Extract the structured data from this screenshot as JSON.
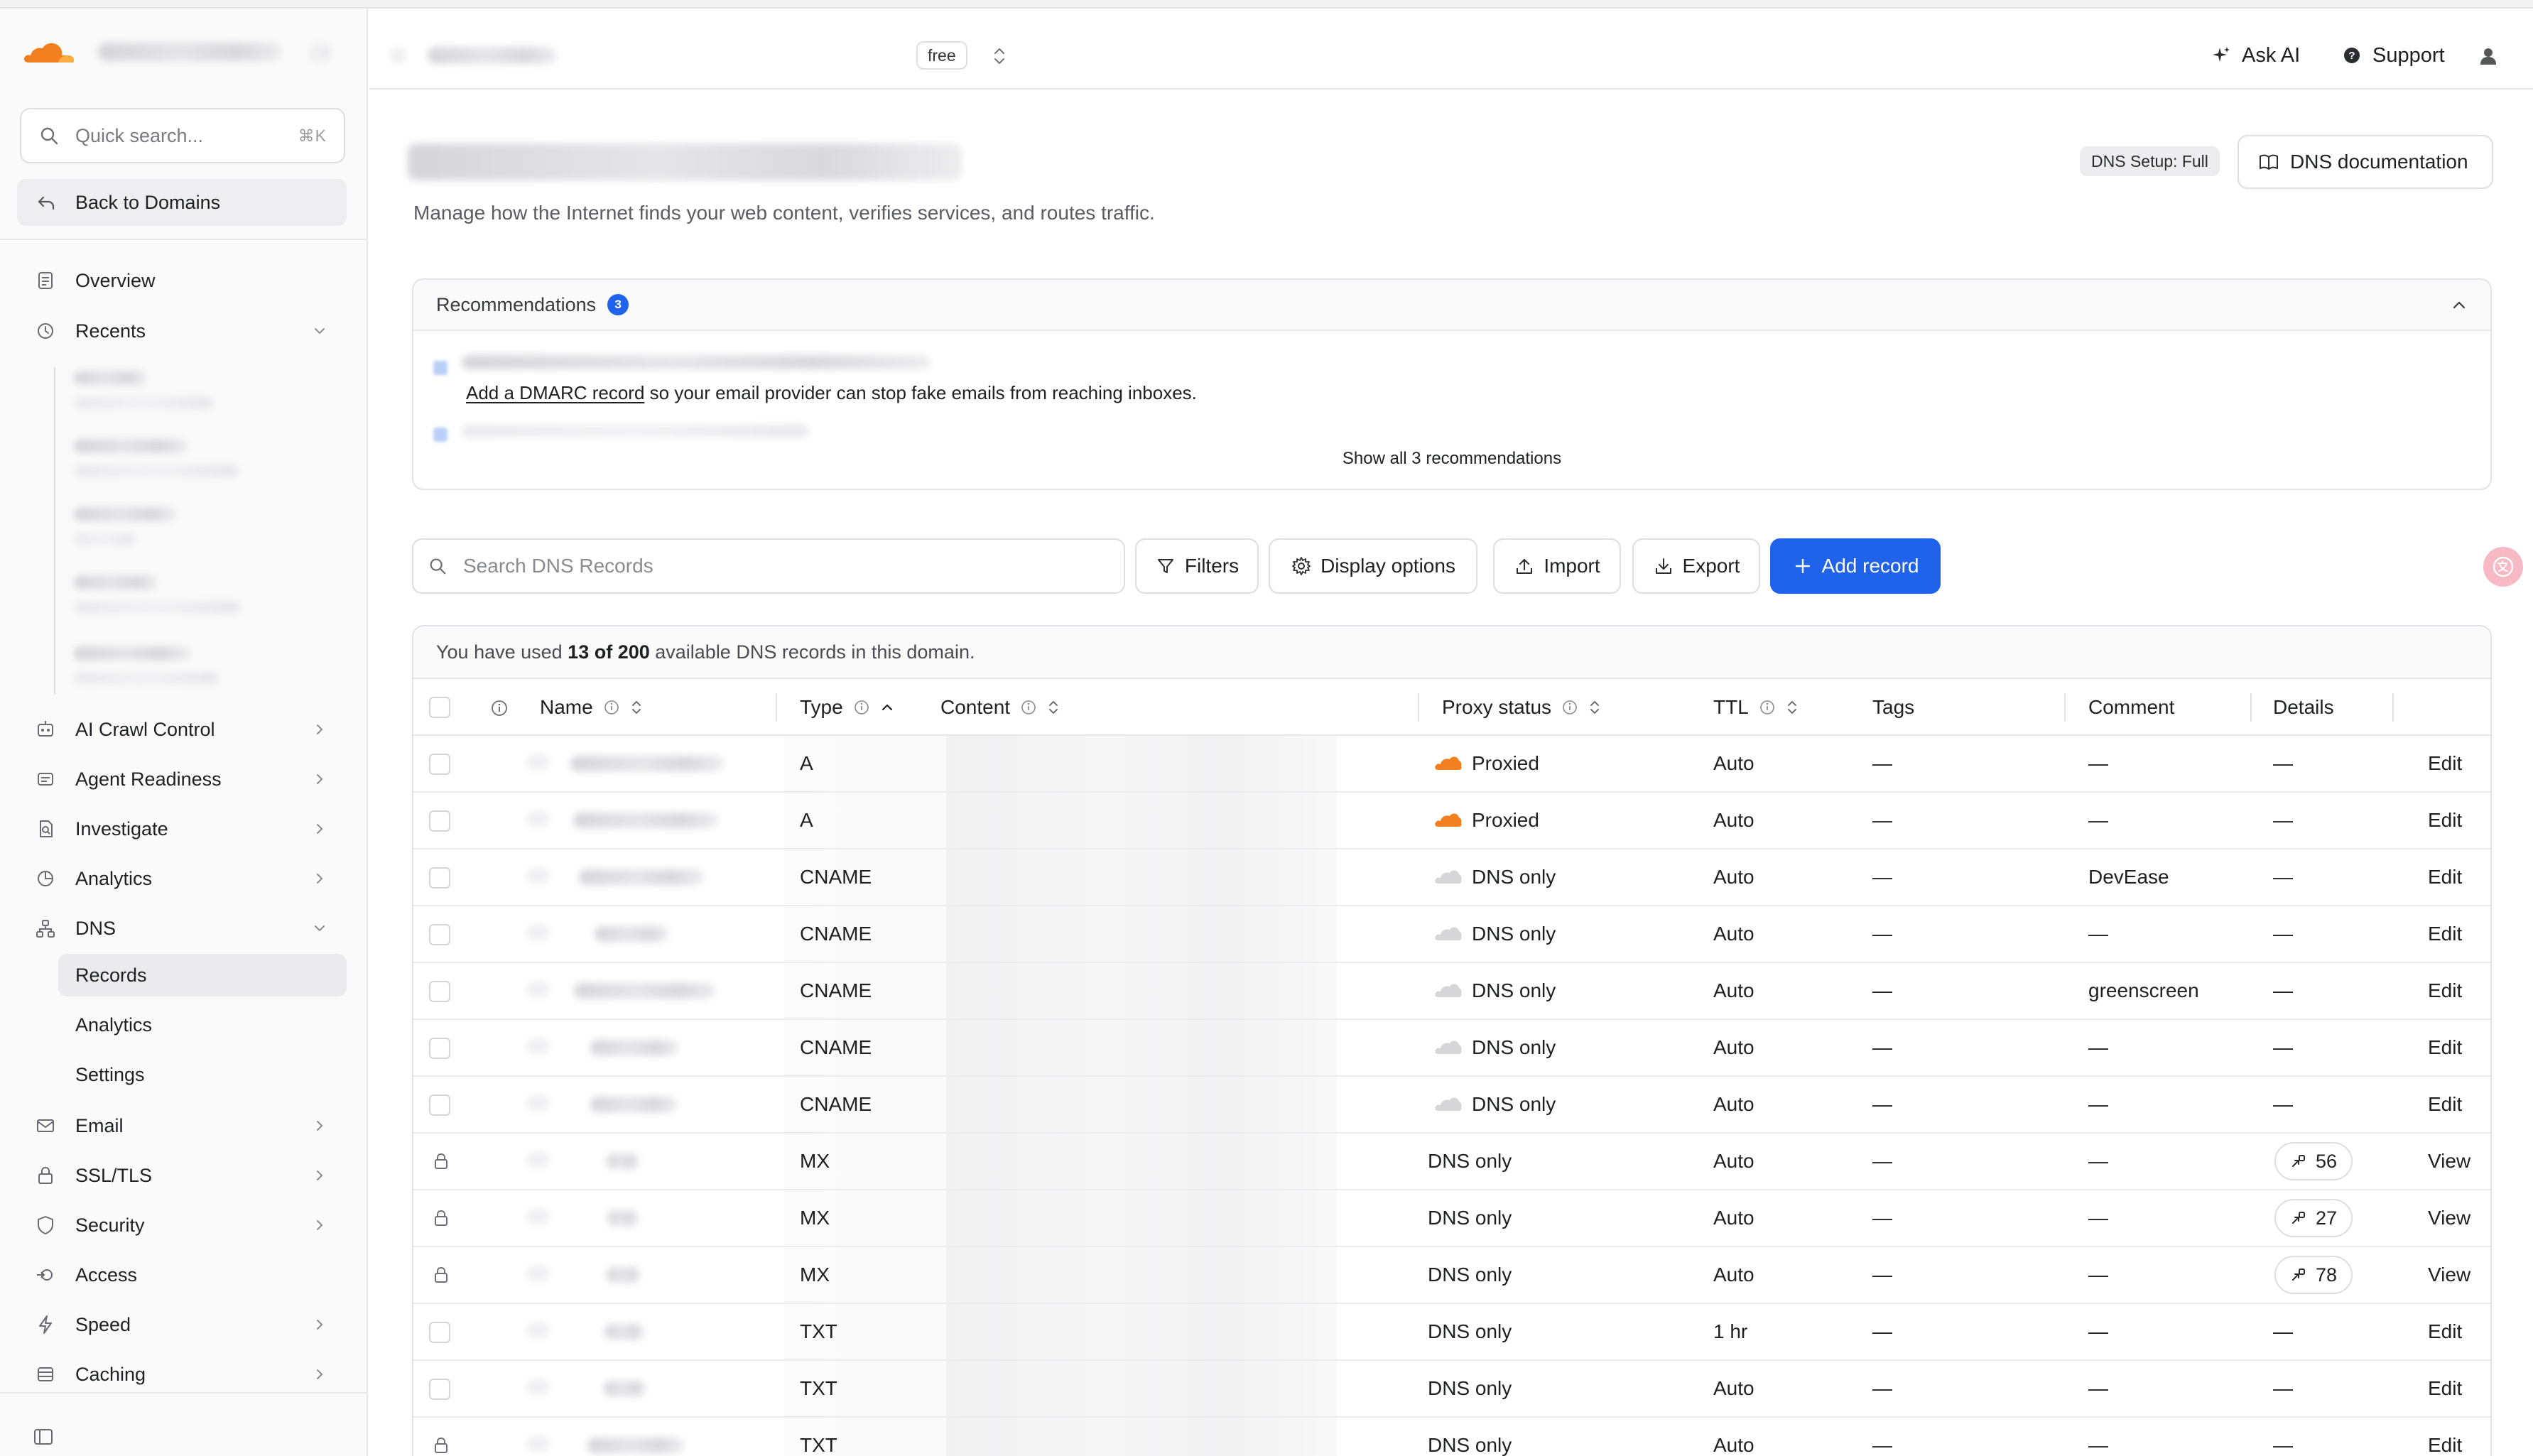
{
  "app": {
    "account_name": "",
    "plan": "free",
    "top_actions": {
      "ask_ai": "Ask AI",
      "support": "Support"
    },
    "accent_color": "#1f63ea",
    "brand_color": "#f38020"
  },
  "sidebar": {
    "search_placeholder": "Quick search...",
    "search_shortcut": "⌘K",
    "back_label": "Back to Domains",
    "overview": "Overview",
    "recents": "Recents",
    "recent_items": [
      {
        "title": "",
        "subtitle": ""
      },
      {
        "title": "",
        "subtitle": ""
      },
      {
        "title": "",
        "subtitle": ""
      },
      {
        "title": "",
        "subtitle": ""
      },
      {
        "title": "",
        "subtitle": ""
      }
    ],
    "nav": [
      {
        "label": "AI Crawl Control",
        "icon": "crawl-icon",
        "chevron": true
      },
      {
        "label": "Agent Readiness",
        "icon": "agent-icon",
        "chevron": true
      },
      {
        "label": "Investigate",
        "icon": "investigate-icon",
        "chevron": true
      },
      {
        "label": "Analytics",
        "icon": "analytics-icon",
        "chevron": true
      },
      {
        "label": "DNS",
        "icon": "dns-icon",
        "chevron": true,
        "expanded": true
      }
    ],
    "dns_sub": [
      {
        "label": "Records",
        "active": true
      },
      {
        "label": "Analytics",
        "active": false
      },
      {
        "label": "Settings",
        "active": false
      }
    ],
    "nav_after": [
      {
        "label": "Email",
        "icon": "email-icon",
        "chevron": true
      },
      {
        "label": "SSL/TLS",
        "icon": "lock-icon",
        "chevron": true
      },
      {
        "label": "Security",
        "icon": "shield-icon",
        "chevron": true
      },
      {
        "label": "Access",
        "icon": "access-icon",
        "chevron": false
      },
      {
        "label": "Speed",
        "icon": "lightning-icon",
        "chevron": true
      },
      {
        "label": "Caching",
        "icon": "caching-icon",
        "chevron": true
      }
    ]
  },
  "header": {
    "title": "",
    "subtitle": "Manage how the Internet finds your web content, verifies services, and routes traffic.",
    "setup_badge": "DNS Setup: Full",
    "doc_button": "DNS documentation"
  },
  "recommendations": {
    "title": "Recommendations",
    "count": "3",
    "dmarc_link": "Add a DMARC record",
    "dmarc_text": " so your email provider can stop fake emails from reaching inboxes.",
    "show_all": "Show all 3 recommendations"
  },
  "toolbar": {
    "search_placeholder": "Search DNS Records",
    "filters": "Filters",
    "display_options": "Display options",
    "import": "Import",
    "export": "Export",
    "add_record": "Add record"
  },
  "usage": {
    "prefix": "You have used ",
    "used": "13 of 200",
    "suffix": " available DNS records in this domain."
  },
  "table": {
    "columns": {
      "name": "Name",
      "type": "Type",
      "content": "Content",
      "proxy_status": "Proxy status",
      "ttl": "TTL",
      "tags": "Tags",
      "comment": "Comment",
      "details": "Details"
    },
    "rows": [
      {
        "name": "",
        "type": "A",
        "content": "",
        "proxy": "Proxied",
        "proxied": true,
        "ttl": "Auto",
        "tags": "—",
        "comment": "—",
        "details": "—",
        "priority": "",
        "action": "Edit",
        "locked": false
      },
      {
        "name": "",
        "type": "A",
        "content": "",
        "proxy": "Proxied",
        "proxied": true,
        "ttl": "Auto",
        "tags": "—",
        "comment": "—",
        "details": "—",
        "priority": "",
        "action": "Edit",
        "locked": false
      },
      {
        "name": "",
        "type": "CNAME",
        "content": "",
        "proxy": "DNS only",
        "proxied": false,
        "ttl": "Auto",
        "tags": "—",
        "comment": "DevEase",
        "details": "—",
        "priority": "",
        "action": "Edit",
        "locked": false
      },
      {
        "name": "",
        "type": "CNAME",
        "content": "",
        "proxy": "DNS only",
        "proxied": false,
        "ttl": "Auto",
        "tags": "—",
        "comment": "—",
        "details": "—",
        "priority": "",
        "action": "Edit",
        "locked": false
      },
      {
        "name": "",
        "type": "CNAME",
        "content": "",
        "proxy": "DNS only",
        "proxied": false,
        "ttl": "Auto",
        "tags": "—",
        "comment": "greenscreen",
        "details": "—",
        "priority": "",
        "action": "Edit",
        "locked": false
      },
      {
        "name": "",
        "type": "CNAME",
        "content": "",
        "proxy": "DNS only",
        "proxied": false,
        "ttl": "Auto",
        "tags": "—",
        "comment": "—",
        "details": "—",
        "priority": "",
        "action": "Edit",
        "locked": false
      },
      {
        "name": "",
        "type": "CNAME",
        "content": "",
        "proxy": "DNS only",
        "proxied": false,
        "ttl": "Auto",
        "tags": "—",
        "comment": "—",
        "details": "—",
        "priority": "",
        "action": "Edit",
        "locked": false
      },
      {
        "name": "",
        "type": "MX",
        "content": "",
        "proxy": "DNS only",
        "proxied": false,
        "ttl": "Auto",
        "tags": "—",
        "comment": "—",
        "details": "",
        "priority": "56",
        "action": "View",
        "locked": true
      },
      {
        "name": "",
        "type": "MX",
        "content": "",
        "proxy": "DNS only",
        "proxied": false,
        "ttl": "Auto",
        "tags": "—",
        "comment": "—",
        "details": "",
        "priority": "27",
        "action": "View",
        "locked": true
      },
      {
        "name": "",
        "type": "MX",
        "content": "",
        "proxy": "DNS only",
        "proxied": false,
        "ttl": "Auto",
        "tags": "—",
        "comment": "—",
        "details": "",
        "priority": "78",
        "action": "View",
        "locked": true
      },
      {
        "name": "",
        "type": "TXT",
        "content": "",
        "proxy": "DNS only",
        "proxied": false,
        "ttl": "1 hr",
        "tags": "—",
        "comment": "—",
        "details": "—",
        "priority": "",
        "action": "Edit",
        "locked": false
      },
      {
        "name": "",
        "type": "TXT",
        "content": "",
        "proxy": "DNS only",
        "proxied": false,
        "ttl": "Auto",
        "tags": "—",
        "comment": "—",
        "details": "—",
        "priority": "",
        "action": "Edit",
        "locked": false
      },
      {
        "name": "",
        "type": "TXT",
        "content": "",
        "proxy": "DNS only",
        "proxied": false,
        "ttl": "Auto",
        "tags": "—",
        "comment": "—",
        "details": "—",
        "priority": "",
        "action": "Edit",
        "locked": true
      }
    ]
  }
}
